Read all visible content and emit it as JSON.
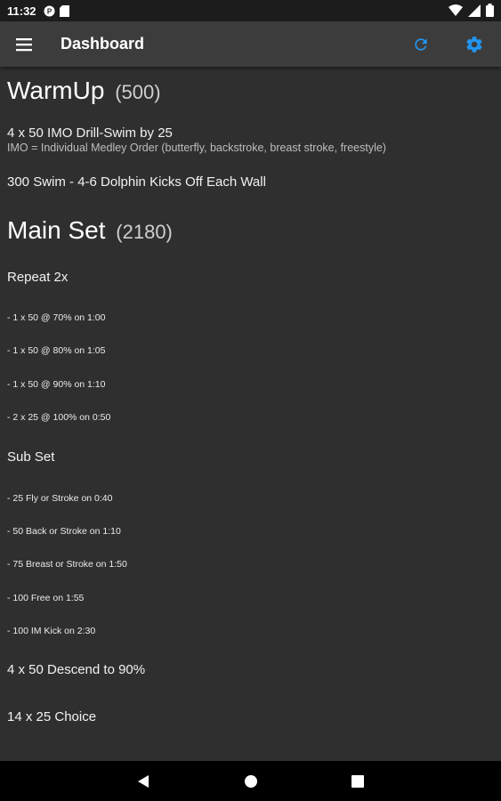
{
  "status_bar": {
    "time": "11:32",
    "icons": [
      "app-notification-icon",
      "sd-card-icon",
      "wifi-icon",
      "signal-icon",
      "battery-icon"
    ]
  },
  "app_bar": {
    "title": "Dashboard",
    "menu_icon": "menu-icon",
    "refresh_icon": "refresh-icon",
    "settings_icon": "settings-icon",
    "accent_color": "#2196f3"
  },
  "warmup": {
    "title": "WarmUp",
    "count": "(500)",
    "items": [
      {
        "text": "4 x 50 IMO Drill-Swim by 25",
        "note": "IMO = Individual Medley Order (butterfly, backstroke, breast stroke, freestyle)"
      },
      {
        "text": "300 Swim - 4-6 Dolphin Kicks Off Each Wall"
      }
    ]
  },
  "main_set": {
    "title": "Main Set",
    "count": "(2180)",
    "repeat_label": "Repeat 2x",
    "repeat_items": [
      " - 1 x 50 @ 70% on 1:00",
      " - 1 x 50 @ 80% on 1:05",
      " - 1 x 50 @ 90% on 1:10",
      " - 2 x 25 @ 100% on 0:50"
    ],
    "subset_label": "Sub Set",
    "subset_items": [
      " - 25 Fly or Stroke on 0:40",
      " - 50 Back or Stroke on 1:10",
      " - 75 Breast or Stroke on 1:50",
      " - 100 Free on 1:55",
      " - 100 IM Kick on 2:30"
    ],
    "extra_items": [
      "4 x 50 Descend to 90%",
      "14 x 25 Choice"
    ]
  },
  "nav_bar": {
    "back_icon": "back-icon",
    "home_icon": "home-icon",
    "recents_icon": "recents-icon"
  }
}
